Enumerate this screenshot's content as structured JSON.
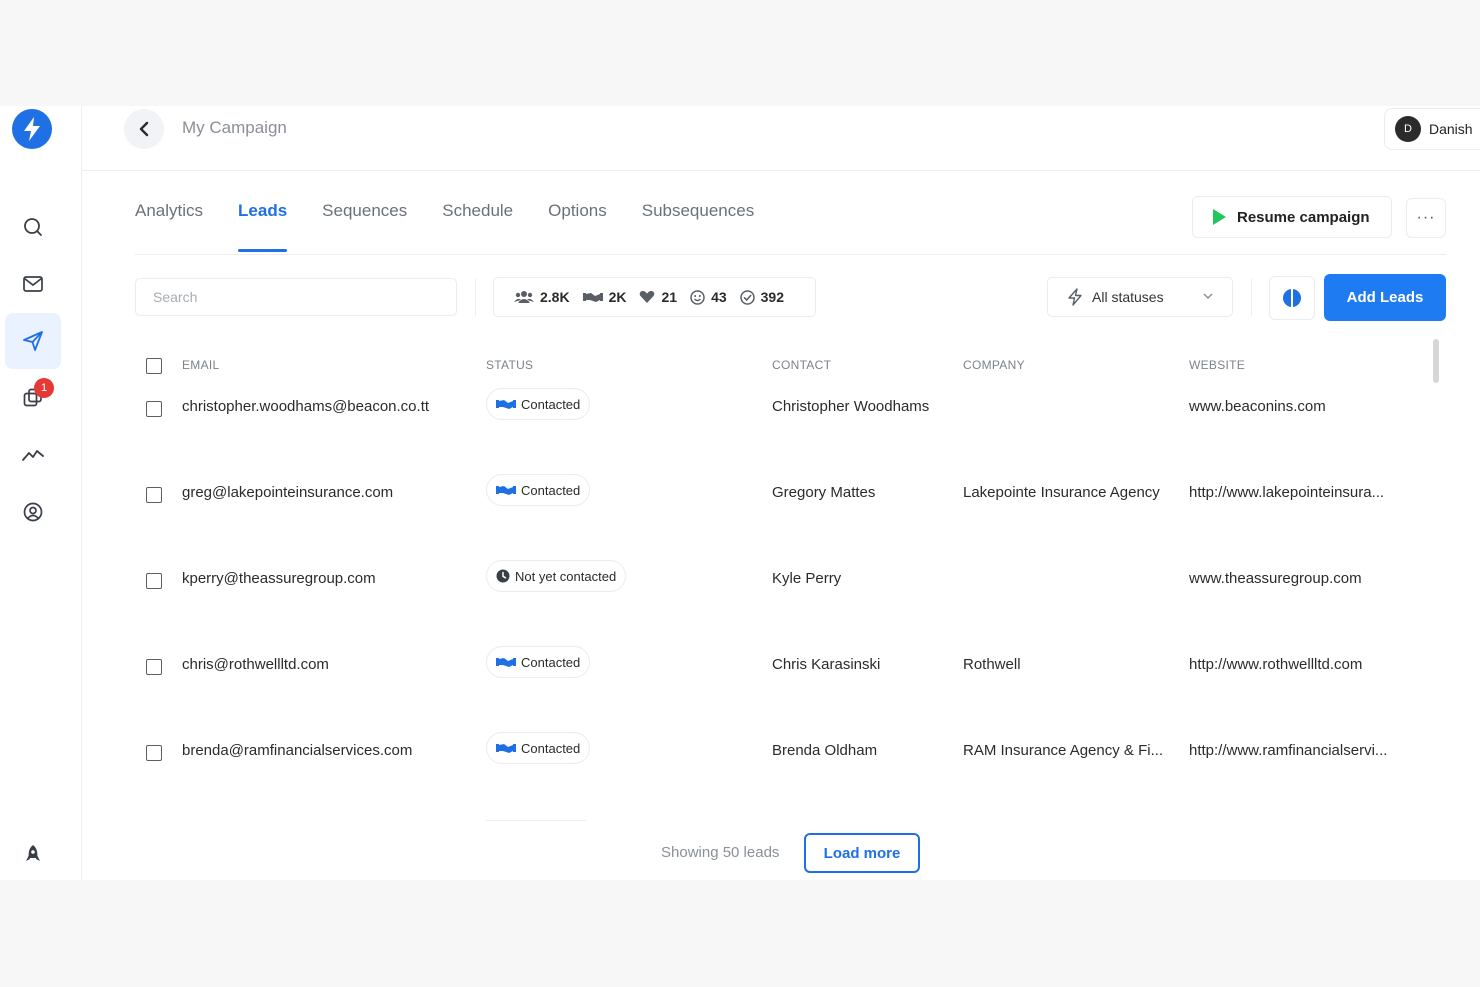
{
  "sidebar": {
    "notification_count": "1"
  },
  "header": {
    "title": "My Campaign",
    "user": {
      "initial": "D",
      "name": "Danish"
    }
  },
  "tabs": [
    {
      "label": "Analytics"
    },
    {
      "label": "Leads"
    },
    {
      "label": "Sequences"
    },
    {
      "label": "Schedule"
    },
    {
      "label": "Options"
    },
    {
      "label": "Subsequences"
    }
  ],
  "actions": {
    "resume_label": "Resume campaign",
    "more_label": "···",
    "add_leads_label": "Add Leads"
  },
  "filters": {
    "search_placeholder": "Search",
    "stats": {
      "total": "2.8K",
      "contacted": "2K",
      "interested": "21",
      "replied": "43",
      "completed": "392"
    },
    "status_select": "All statuses"
  },
  "table": {
    "headers": {
      "email": "EMAIL",
      "status": "STATUS",
      "contact": "CONTACT",
      "company": "COMPANY",
      "website": "WEBSITE"
    },
    "rows": [
      {
        "email": "christopher.woodhams@beacon.co.tt",
        "status": "Contacted",
        "contact": "Christopher Woodhams",
        "company": "",
        "website": "www.beaconins.com"
      },
      {
        "email": "greg@lakepointeinsurance.com",
        "status": "Contacted",
        "contact": "Gregory Mattes",
        "company": "Lakepointe Insurance Agency",
        "website": "http://www.lakepointeinsura..."
      },
      {
        "email": "kperry@theassuregroup.com",
        "status": "Not yet contacted",
        "contact": "Kyle Perry",
        "company": "",
        "website": "www.theassuregroup.com"
      },
      {
        "email": "chris@rothwellltd.com",
        "status": "Contacted",
        "contact": "Chris Karasinski",
        "company": "Rothwell",
        "website": "http://www.rothwellltd.com"
      },
      {
        "email": "brenda@ramfinancialservices.com",
        "status": "Contacted",
        "contact": "Brenda Oldham",
        "company": "RAM Insurance Agency & Fi...",
        "website": "http://www.ramfinancialservi..."
      }
    ]
  },
  "footer": {
    "showing_text": "Showing 50 leads",
    "load_more_label": "Load more"
  },
  "colors": {
    "accent": "#1f6fe5",
    "primary_button": "#1f7bf2",
    "play_green": "#22c55e",
    "notification": "#e53935"
  }
}
